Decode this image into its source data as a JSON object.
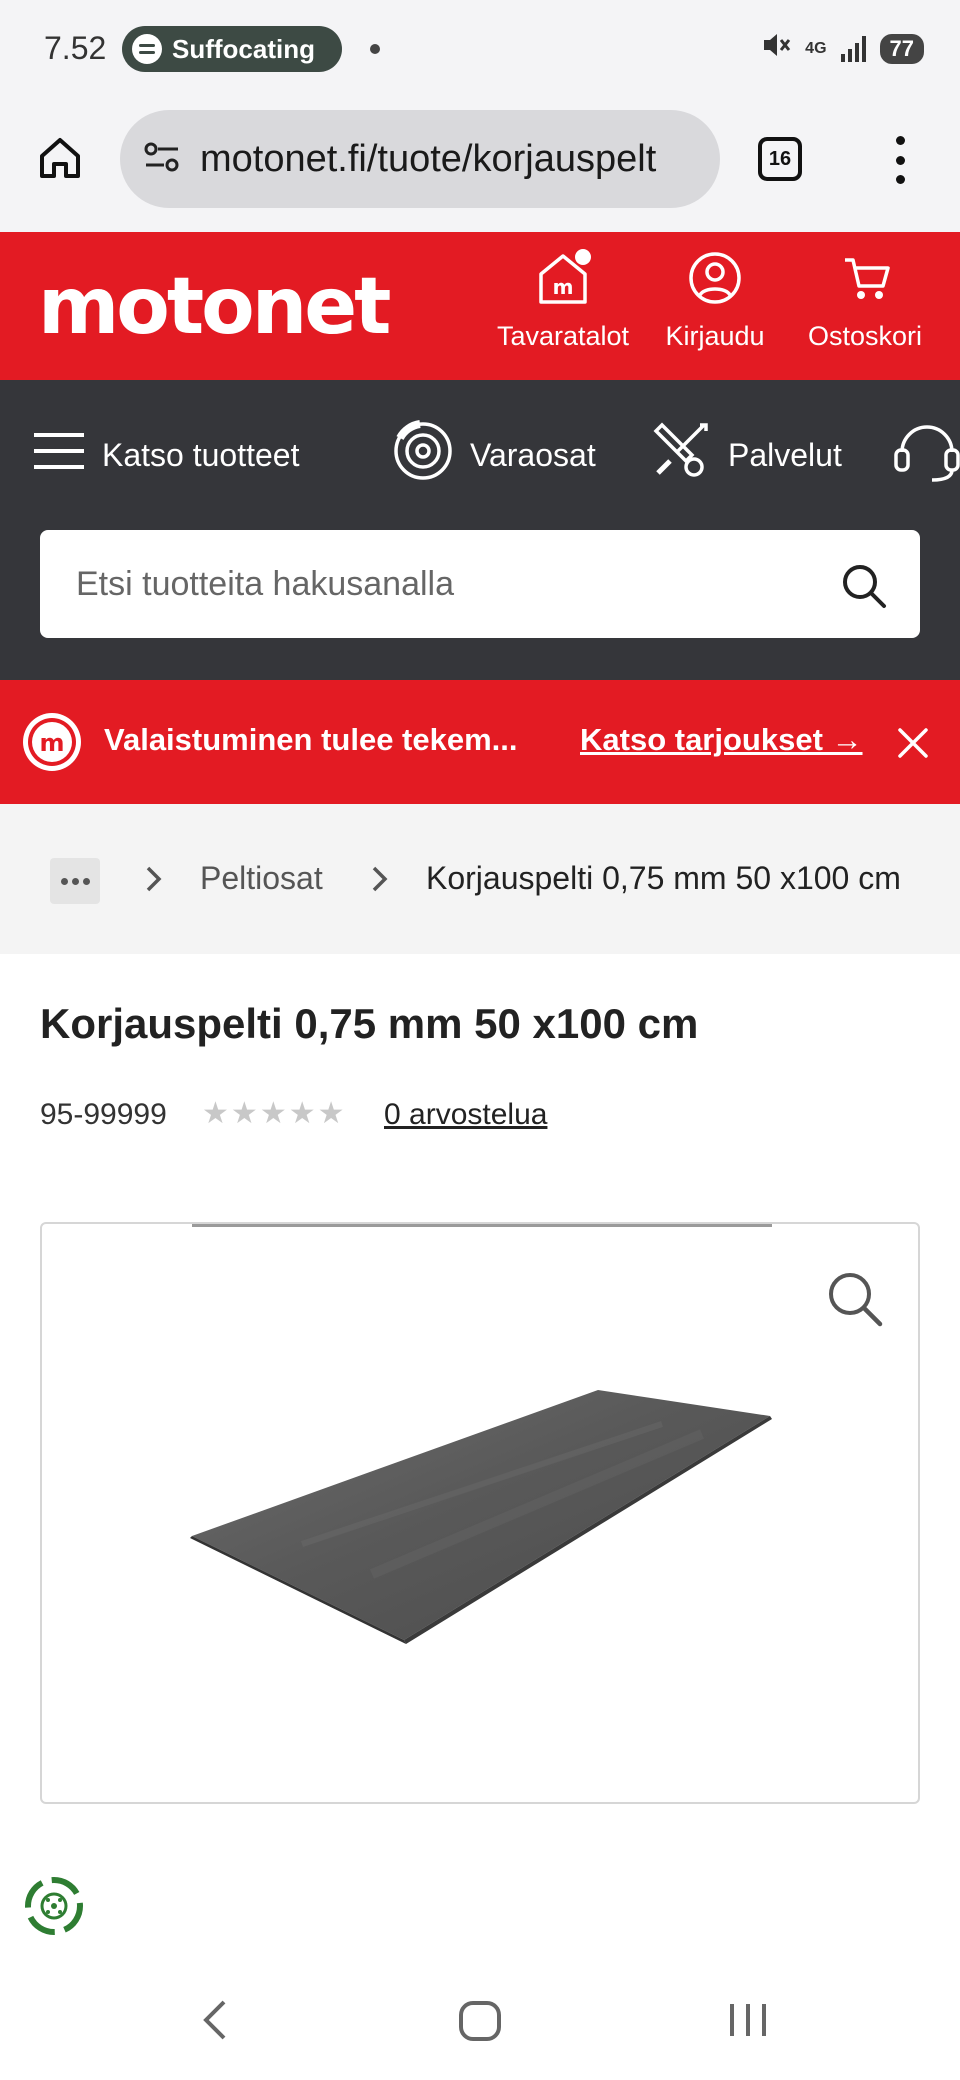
{
  "status_bar": {
    "time": "7.52",
    "media_text": "Suffocating",
    "network": "4G",
    "battery": "77"
  },
  "browser": {
    "url": "motonet.fi/tuote/korjauspelt",
    "tab_count": "16"
  },
  "header": {
    "logo": "motonet",
    "items": [
      {
        "label": "Tavaratalot",
        "icon": "store-icon"
      },
      {
        "label": "Kirjaudu",
        "icon": "user-icon"
      },
      {
        "label": "Ostoskori",
        "icon": "cart-icon"
      }
    ]
  },
  "nav": {
    "items": [
      {
        "label": "Katso tuotteet",
        "icon": "hamburger-icon"
      },
      {
        "label": "Varaosat",
        "icon": "brake-disc-icon"
      },
      {
        "label": "Palvelut",
        "icon": "tools-icon"
      }
    ]
  },
  "search": {
    "placeholder": "Etsi tuotteita hakusanalla"
  },
  "promo": {
    "text": "Valaistuminen tulee tekem...",
    "link": "Katso tarjoukset →"
  },
  "breadcrumb": {
    "parent": "Peltiosat",
    "current": "Korjauspelti 0,75 mm 50 x100 cm"
  },
  "product": {
    "title": "Korjauspelti 0,75 mm 50 x100 cm",
    "sku": "95-99999",
    "rating": 0,
    "rating_max": 5,
    "reviews": "0 arvostelua"
  },
  "colors": {
    "brand_red": "#e31b23",
    "nav_dark": "#35363a"
  }
}
